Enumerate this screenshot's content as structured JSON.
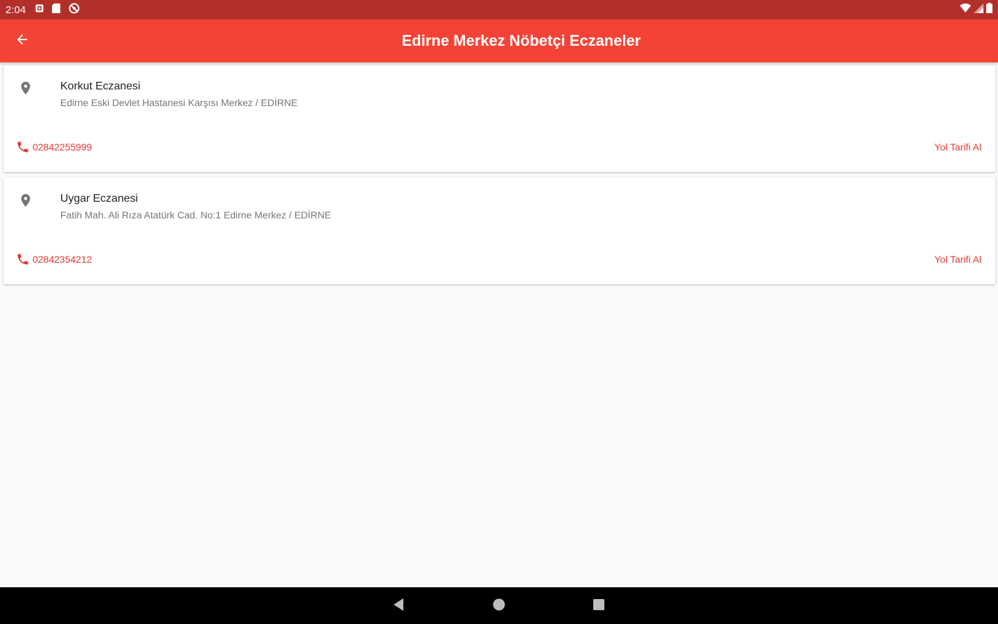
{
  "status_bar": {
    "time": "2:04",
    "left_icons": [
      "notification-icon",
      "sd-card-icon",
      "no-sim-icon"
    ],
    "right_icons": [
      "wifi-icon",
      "signal-icon",
      "battery-icon"
    ]
  },
  "app_bar": {
    "title": "Edirne Merkez Nöbetçi Eczaneler",
    "back_icon": "arrow-back-icon",
    "background": "#f44336"
  },
  "pharmacies": [
    {
      "name": "Korkut Eczanesi",
      "address": "Edirne Eski Devlet Hastanesi Karşısı Merkez / EDİRNE",
      "phone": "02842255999",
      "directions_label": "Yol Tarifi Al"
    },
    {
      "name": "Uygar Eczanesi",
      "address": "Fatih Mah. Ali Rıza Atatürk Cad. No:1 Edirne Merkez / EDİRNE",
      "phone": "02842354212",
      "directions_label": "Yol Tarifi Al"
    }
  ],
  "colors": {
    "accent": "#e53935",
    "status_bar": "#b3302a"
  },
  "nav_bar": {
    "buttons": [
      "back-triangle-icon",
      "home-circle-icon",
      "recents-square-icon"
    ]
  }
}
